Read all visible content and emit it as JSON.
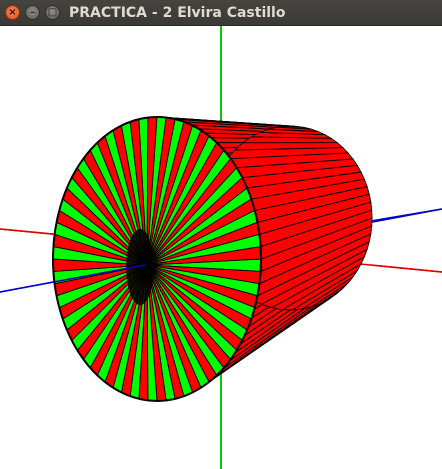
{
  "window": {
    "title": "PRACTICA - 2 Elvira Castillo",
    "close_glyph": "×",
    "minimize_glyph": "–",
    "maximize_glyph": "□"
  },
  "scene": {
    "background": "#ffffff",
    "axes": {
      "x_color": "#e00000",
      "y_color": "#00d000",
      "z_color": "#0000c8"
    },
    "cylinder": {
      "color_a": "#00ff00",
      "color_b": "#ff0000",
      "edge_color": "#000000",
      "segments": 72
    }
  }
}
